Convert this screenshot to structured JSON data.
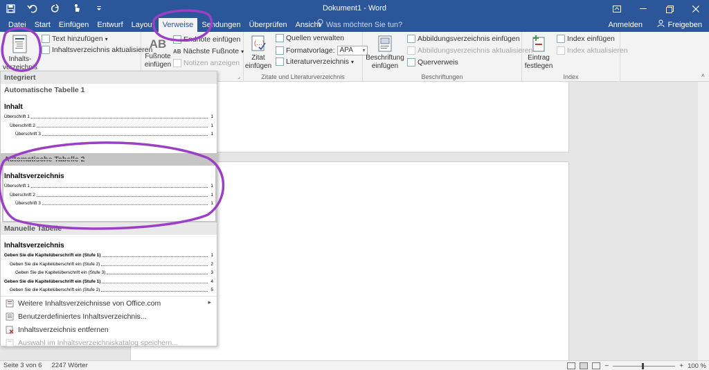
{
  "window": {
    "title": "Dokument1 - Word",
    "qat_icons": [
      "save-icon",
      "undo-icon",
      "redo-icon",
      "touch-mode-icon",
      "customize-icon"
    ]
  },
  "tabs": [
    {
      "label": "Datei",
      "active": false
    },
    {
      "label": "Start",
      "active": false
    },
    {
      "label": "Einfügen",
      "active": false
    },
    {
      "label": "Entwurf",
      "active": false
    },
    {
      "label": "Layout",
      "active": false
    },
    {
      "label": "Verweise",
      "active": true
    },
    {
      "label": "Sendungen",
      "active": false
    },
    {
      "label": "Überprüfen",
      "active": false
    },
    {
      "label": "Ansicht",
      "active": false
    }
  ],
  "tell_me": "Was möchten Sie tun?",
  "signin": "Anmelden",
  "share": "Freigeben",
  "ribbon": {
    "toc": {
      "button_label": "Inhalts-\nverzeichnis",
      "add_text": "Text hinzufügen",
      "update": "Inhaltsverzeichnis aktualisieren"
    },
    "footnotes": {
      "insert_footnote": "Fußnote\neinfügen",
      "insert_endnote": "Endnote einfügen",
      "next_footnote": "Nächste Fußnote",
      "show_notes": "Notizen anzeigen",
      "ab_glyph": "AB",
      "ab_small": "AB"
    },
    "citations": {
      "insert_citation": "Zitat\neinfügen",
      "manage_sources": "Quellen verwalten",
      "style_label": "Formatvorlage:",
      "style_value": "APA",
      "bibliography": "Literaturverzeichnis",
      "group_label": "Zitate und Literaturverzeichnis"
    },
    "captions": {
      "insert_caption": "Beschriftung\neinfügen",
      "insert_table_of_figures": "Abbildungsverzeichnis einfügen",
      "update_table": "Abbildungsverzeichnis aktualisieren",
      "cross_reference": "Querverweis",
      "group_label": "Beschriftungen"
    },
    "index": {
      "mark_entry": "Eintrag\nfestlegen",
      "insert_index": "Index einfügen",
      "update_index": "Index aktualisieren",
      "group_label": "Index"
    }
  },
  "gallery": {
    "header_integrated": "Integriert",
    "auto1": {
      "heading": "Automatische Tabelle 1",
      "title": "Inhalt",
      "lines": [
        {
          "text": "Überschrift 1",
          "page": "1",
          "level": 1
        },
        {
          "text": "Überschrift 2",
          "page": "1",
          "level": 2
        },
        {
          "text": "Überschrift 3",
          "page": "1",
          "level": 3
        }
      ]
    },
    "auto2": {
      "heading": "Automatische Tabelle 2",
      "title": "Inhaltsverzeichnis",
      "lines": [
        {
          "text": "Überschrift 1",
          "page": "1",
          "level": 1
        },
        {
          "text": "Überschrift 2",
          "page": "1",
          "level": 2
        },
        {
          "text": "Überschrift 3",
          "page": "1",
          "level": 3
        }
      ]
    },
    "manual": {
      "heading": "Manuelle Tabelle",
      "title": "Inhaltsverzeichnis",
      "lines": [
        {
          "text": "Geben Sie die Kapitelüberschrift ein (Stufe 1)",
          "page": "1",
          "level": 1
        },
        {
          "text": "Geben Sie die Kapitelüberschrift ein (Stufe 2)",
          "page": "2",
          "level": 2
        },
        {
          "text": "Geben Sie die Kapitelüberschrift ein (Stufe 3)",
          "page": "3",
          "level": 3
        },
        {
          "text": "Geben Sie die Kapitelüberschrift ein (Stufe 1)",
          "page": "4",
          "level": 1
        },
        {
          "text": "Geben Sie die Kapitelüberschrift ein (Stufe 2)",
          "page": "5",
          "level": 2
        }
      ]
    },
    "menu": [
      {
        "label": "Weitere Inhaltsverzeichnisse von Office.com",
        "icon": "office-icon",
        "disabled": false,
        "submenu": true
      },
      {
        "label": "Benutzerdefiniertes Inhaltsverzeichnis...",
        "icon": "custom-toc-icon",
        "disabled": false,
        "submenu": false
      },
      {
        "label": "Inhaltsverzeichnis entfernen",
        "icon": "remove-toc-icon",
        "disabled": false,
        "submenu": false
      },
      {
        "label": "Auswahl im Inhaltsverzeichniskatalog speichern...",
        "icon": "save-selection-icon",
        "disabled": true,
        "submenu": false
      }
    ]
  },
  "status": {
    "page": "Seite 3 von 6",
    "words": "2247 Wörter",
    "zoom": "100 %"
  },
  "colors": {
    "title_bar": "#2b579a",
    "annotation": "#9b3fc4"
  }
}
